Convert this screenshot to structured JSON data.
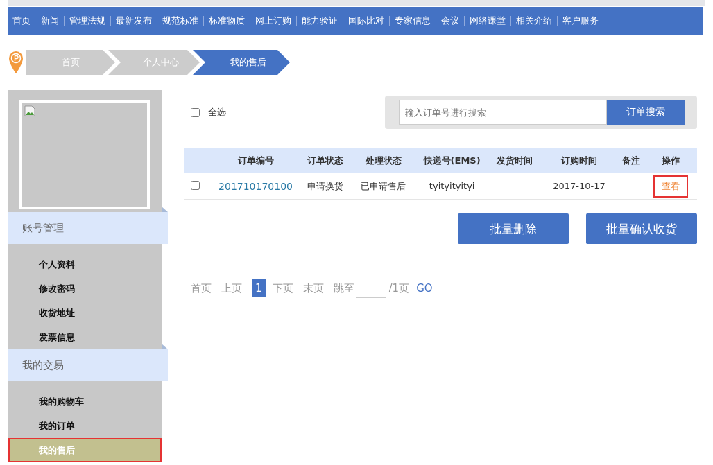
{
  "nav": [
    {
      "label": "首页",
      "selected": false
    },
    {
      "label": "新闻",
      "selected": false
    },
    {
      "label": "管理法规",
      "selected": false
    },
    {
      "label": "最新发布",
      "selected": false
    },
    {
      "label": "规范标准",
      "selected": false
    },
    {
      "label": "标准物质",
      "selected": false
    },
    {
      "label": "网上订购",
      "selected": false
    },
    {
      "label": "能力验证",
      "selected": false
    },
    {
      "label": "国际比对",
      "selected": false
    },
    {
      "label": "专家信息",
      "selected": false
    },
    {
      "label": "会议",
      "selected": false
    },
    {
      "label": "网络课堂",
      "selected": false
    },
    {
      "label": "相关介绍",
      "selected": false
    },
    {
      "label": "客户服务",
      "selected": false
    }
  ],
  "breadcrumb": [
    {
      "label": "首页",
      "selected": false
    },
    {
      "label": "个人中心",
      "selected": false
    },
    {
      "label": "我的售后",
      "selected": true
    }
  ],
  "sidebar": {
    "groups": [
      {
        "title": "账号管理",
        "items": [
          {
            "label": "个人资料",
            "selected": false
          },
          {
            "label": "修改密码",
            "selected": false
          },
          {
            "label": "收货地址",
            "selected": false
          },
          {
            "label": "发票信息",
            "selected": false
          }
        ]
      },
      {
        "title": "我的交易",
        "items": [
          {
            "label": "我的购物车",
            "selected": false
          },
          {
            "label": "我的订单",
            "selected": false
          },
          {
            "label": "我的售后",
            "selected": true
          }
        ]
      }
    ]
  },
  "select_all": {
    "label": "全选",
    "checked": false
  },
  "search": {
    "placeholder": "输入订单号进行搜索",
    "button": "订单搜索"
  },
  "table": {
    "columns": [
      "订单编号",
      "订单状态",
      "处理状态",
      "快递号(EMS)",
      "发货时间",
      "订购时间",
      "备注",
      "操作"
    ],
    "rows": [
      {
        "checked": false,
        "order_no": "201710170100",
        "order_status": "申请换货",
        "process_status": "已申请售后",
        "tracking": "tyityityityi",
        "ship_time": "",
        "order_time": "2017-10-17",
        "note": "",
        "action": "查看",
        "action_highlighted": true
      }
    ]
  },
  "actions": [
    "批量删除",
    "批量确认收货"
  ],
  "pagination": {
    "first": "首页",
    "prev": "上页",
    "pages": [
      {
        "label": "1",
        "selected": true
      }
    ],
    "next": "下页",
    "last": "末页",
    "jump": "跳至",
    "total": "/1页",
    "go": "GO"
  }
}
